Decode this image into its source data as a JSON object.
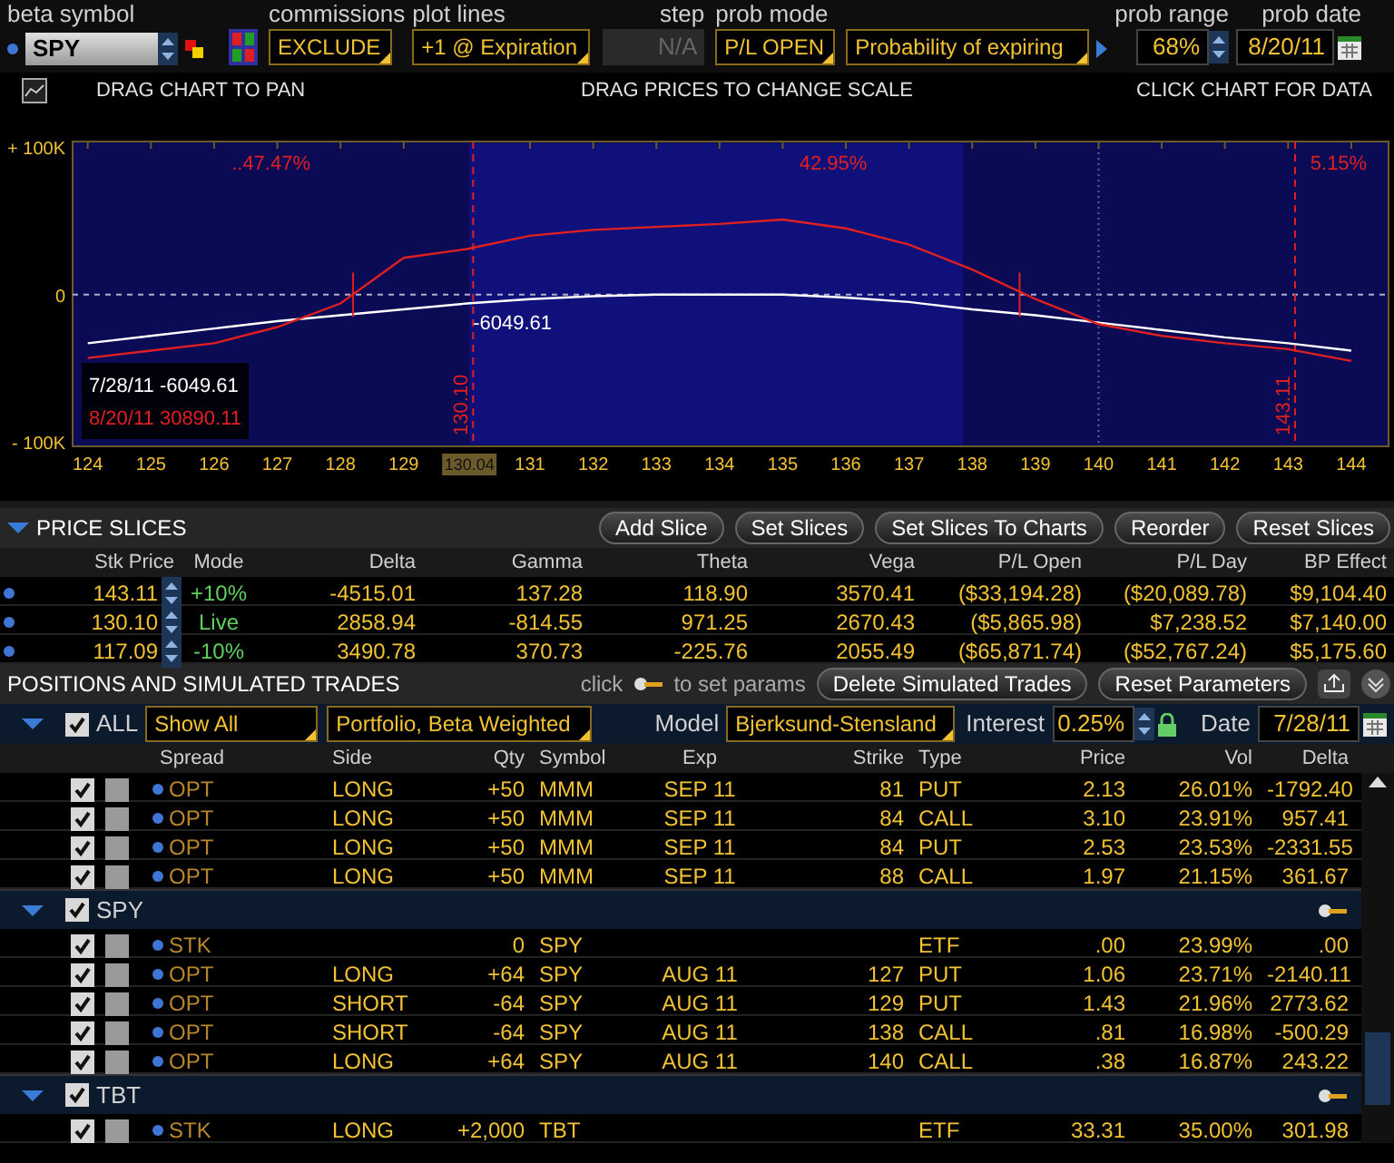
{
  "toolbar": {
    "beta_symbol": {
      "label": "beta symbol",
      "value": "SPY"
    },
    "commissions": {
      "label": "commissions",
      "value": "EXCLUDE"
    },
    "plot_lines": {
      "label": "plot lines",
      "value": "+1 @ Expiration"
    },
    "step": {
      "label": "step",
      "value": "N/A",
      "disabled": true
    },
    "prob_mode": {
      "label": "prob mode",
      "value": "P/L OPEN",
      "option": "Probability of expiring"
    },
    "prob_range": {
      "label": "prob range",
      "value": "68%"
    },
    "prob_date": {
      "label": "prob date",
      "value": "8/20/11"
    }
  },
  "chart_hints": [
    "DRAG CHART TO PAN",
    "DRAG PRICES TO CHANGE SCALE",
    "CLICK CHART FOR DATA"
  ],
  "chart": {
    "chart_data": {
      "type": "line",
      "x": [
        124,
        125,
        126,
        127,
        128,
        129,
        130,
        131,
        132,
        133,
        134,
        135,
        136,
        137,
        138,
        139,
        140,
        141,
        142,
        143,
        144
      ],
      "series": [
        {
          "name": "7/28/11",
          "color": "#ffffff",
          "values": [
            -33000,
            -28000,
            -23000,
            -18000,
            -14000,
            -10000,
            -6000,
            -3000,
            -1000,
            0,
            0,
            0,
            -2000,
            -5000,
            -10000,
            -14000,
            -19000,
            -24000,
            -29000,
            -33000,
            -38000
          ]
        },
        {
          "name": "8/20/11",
          "color": "#e02020",
          "values": [
            -43000,
            -38000,
            -33000,
            -22000,
            -6000,
            25000,
            31000,
            40000,
            44000,
            46000,
            48000,
            51000,
            45000,
            34000,
            17000,
            -3000,
            -20000,
            -28000,
            -33000,
            -37000,
            -45000
          ]
        }
      ],
      "xlim": [
        123.76,
        144.59
      ],
      "ylim": [
        -103000,
        104000
      ],
      "xticks": [
        124,
        125,
        126,
        127,
        128,
        129,
        131,
        132,
        133,
        134,
        135,
        136,
        137,
        138,
        139,
        140,
        141,
        142,
        143,
        144
      ],
      "yticks": [
        {
          "value": 100000,
          "label": "+ 100K"
        },
        {
          "value": 0,
          "label": "0"
        },
        {
          "value": -100000,
          "label": "- 100K"
        }
      ],
      "ref_lines": [
        {
          "axis": "y",
          "value": 0
        },
        {
          "axis": "x",
          "value": 140
        },
        {
          "axis": "x",
          "value": 130.1,
          "label": "130.10"
        },
        {
          "axis": "x",
          "value": 143.11,
          "label": "143.11"
        }
      ]
    },
    "probability_labels": [
      "..47.47%",
      "42.95%",
      "5.15%"
    ],
    "point_label": "-6049.61",
    "cursor_label": "130.04",
    "legend_values": [
      "-6049.61",
      "30890.11"
    ]
  },
  "price_slices": {
    "title": "PRICE SLICES",
    "buttons": [
      "Add Slice",
      "Set Slices",
      "Set Slices To Charts",
      "Reorder",
      "Reset Slices"
    ],
    "columns": [
      "Stk Price",
      "Mode",
      "Delta",
      "Gamma",
      "Theta",
      "Vega",
      "P/L Open",
      "P/L Day",
      "BP Effect"
    ],
    "rows": [
      {
        "stk_price": "143.11",
        "mode": "+10%",
        "delta": "-4515.01",
        "gamma": "137.28",
        "theta": "118.90",
        "vega": "3570.41",
        "pl_open": "($33,194.28)",
        "pl_day": "($20,089.78)",
        "bp_effect": "$9,104.40"
      },
      {
        "stk_price": "130.10",
        "mode": "Live",
        "delta": "2858.94",
        "gamma": "-814.55",
        "theta": "971.25",
        "vega": "2670.43",
        "pl_open": "($5,865.98)",
        "pl_day": "$7,238.52",
        "bp_effect": "$7,140.00"
      },
      {
        "stk_price": "117.09",
        "mode": "-10%",
        "delta": "3490.78",
        "gamma": "370.73",
        "theta": "-225.76",
        "vega": "2055.49",
        "pl_open": "($65,871.74)",
        "pl_day": "($52,767.24)",
        "bp_effect": "$5,175.60"
      }
    ]
  },
  "positions": {
    "title": "POSITIONS AND SIMULATED TRADES",
    "hint_before": "click",
    "hint_after": "to set params",
    "buttons": [
      "Delete Simulated Trades",
      "Reset Parameters"
    ],
    "all_checked": true,
    "all_label": "ALL",
    "filter": "Show All",
    "view": "Portfolio, Beta Weighted",
    "model_label": "Model",
    "model": "Bjerksund-Stensland",
    "interest_label": "Interest",
    "interest": "0.25%",
    "date_label": "Date",
    "date": "7/28/11",
    "columns": [
      "Spread",
      "Side",
      "Qty",
      "Symbol",
      "Exp",
      "Strike",
      "Type",
      "Price",
      "Vol",
      "Delta"
    ],
    "groups": [
      {
        "rows": [
          {
            "checked": true,
            "spread": "OPT",
            "side": "LONG",
            "qty": "+50",
            "symbol": "MMM",
            "exp": "SEP 11",
            "strike": "81",
            "type": "PUT",
            "price": "2.13",
            "vol": "26.01%",
            "delta": "-1792.40"
          },
          {
            "checked": true,
            "spread": "OPT",
            "side": "LONG",
            "qty": "+50",
            "symbol": "MMM",
            "exp": "SEP 11",
            "strike": "84",
            "type": "CALL",
            "price": "3.10",
            "vol": "23.91%",
            "delta": "957.41"
          },
          {
            "checked": true,
            "spread": "OPT",
            "side": "LONG",
            "qty": "+50",
            "symbol": "MMM",
            "exp": "SEP 11",
            "strike": "84",
            "type": "PUT",
            "price": "2.53",
            "vol": "23.53%",
            "delta": "-2331.55"
          },
          {
            "checked": true,
            "spread": "OPT",
            "side": "LONG",
            "qty": "+50",
            "symbol": "MMM",
            "exp": "SEP 11",
            "strike": "88",
            "type": "CALL",
            "price": "1.97",
            "vol": "21.15%",
            "delta": "361.67"
          }
        ]
      },
      {
        "title": "SPY",
        "checked": true,
        "expanded": true,
        "rows": [
          {
            "checked": true,
            "spread": "STK",
            "qty": "0",
            "symbol": "SPY",
            "type": "ETF",
            "price": ".00",
            "vol": "23.99%",
            "delta": ".00"
          },
          {
            "checked": true,
            "spread": "OPT",
            "side": "LONG",
            "qty": "+64",
            "symbol": "SPY",
            "exp": "AUG 11",
            "strike": "127",
            "type": "PUT",
            "price": "1.06",
            "vol": "23.71%",
            "delta": "-2140.11"
          },
          {
            "checked": true,
            "spread": "OPT",
            "side": "SHORT",
            "qty": "-64",
            "symbol": "SPY",
            "exp": "AUG 11",
            "strike": "129",
            "type": "PUT",
            "price": "1.43",
            "vol": "21.96%",
            "delta": "2773.62"
          },
          {
            "checked": true,
            "spread": "OPT",
            "side": "SHORT",
            "qty": "-64",
            "symbol": "SPY",
            "exp": "AUG 11",
            "strike": "138",
            "type": "CALL",
            "price": ".81",
            "vol": "16.98%",
            "delta": "-500.29"
          },
          {
            "checked": true,
            "spread": "OPT",
            "side": "LONG",
            "qty": "+64",
            "symbol": "SPY",
            "exp": "AUG 11",
            "strike": "140",
            "type": "CALL",
            "price": ".38",
            "vol": "16.87%",
            "delta": "243.22"
          }
        ]
      },
      {
        "title": "TBT",
        "checked": true,
        "expanded": true,
        "rows": [
          {
            "checked": true,
            "spread": "STK",
            "side": "LONG",
            "qty": "+2,000",
            "symbol": "TBT",
            "type": "ETF",
            "price": "33.31",
            "vol": "35.00%",
            "delta": "301.98"
          }
        ]
      }
    ]
  }
}
